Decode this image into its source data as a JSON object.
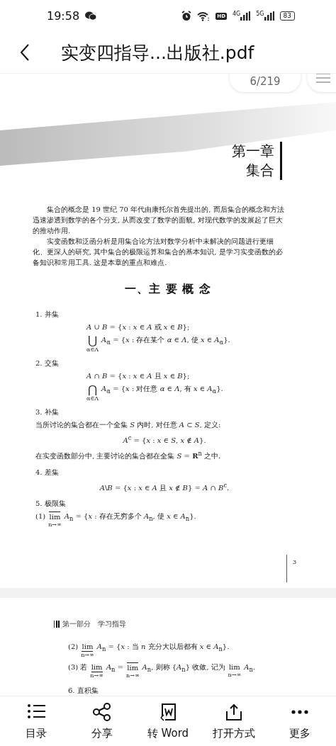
{
  "status_bar": {
    "time": "19:58",
    "hd": "HD",
    "networks": [
      "4G",
      "5G"
    ],
    "battery": "83"
  },
  "header": {
    "title": "实变四指导...出版社.pdf"
  },
  "page_indicator": "6/219",
  "page1": {
    "chapter": {
      "number": "第一章",
      "title": "集合"
    },
    "paragraphs": [
      "集合的概念是 19 世纪 70 年代由康托尔首先提出的, 而后集合的概念和方法迅速渗透到数学的各个分支, 从而改变了数学的面貌, 对现代数学的发展起了巨大的推动作用.",
      "实变函数和泛函分析是用集合论方法对数学分析中未解决的问题进行更细化、更深人的研究, 其中集合的极限运算和集合的基本知识, 是学习实变函数的必备知识和常用工具. 这是本章的重点和难点."
    ],
    "section_heading": "一、主 要 概 念",
    "lines": [
      {
        "kind": "heading",
        "parts": [
          {
            "text": "1. 并集"
          }
        ]
      },
      {
        "kind": "formula",
        "parts": [
          {
            "text": "*A* ∪ *B* = {*x* : *x* ∈ *A* 或 *x* ∈ *B*};"
          }
        ]
      },
      {
        "kind": "formula",
        "parts": [
          {
            "op": "⋃",
            "overline": false,
            "underline": false,
            "under": "α∈Λ"
          },
          {
            "text": "*A*$_{α}$ = {*x* : 存在某个 *α* ∈ *Λ*, 使 *x* ∈ *A*$_{α}$}."
          }
        ]
      },
      {
        "kind": "heading",
        "parts": [
          {
            "text": "2. 交集"
          }
        ]
      },
      {
        "kind": "formula",
        "parts": [
          {
            "text": "*A* ∩ *B* = {*x* : *x* ∈ *A* 且 *x* ∈ *B*};"
          }
        ]
      },
      {
        "kind": "formula",
        "parts": [
          {
            "op": "⋂",
            "overline": false,
            "underline": false,
            "under": "α∈Λ"
          },
          {
            "text": "*A*$_{α}$ = {*x* : 对任意 *α* ∈ *Λ*, 有 *x* ∈ *A*$_{α}$}."
          }
        ]
      },
      {
        "kind": "heading",
        "parts": [
          {
            "text": "3. 补集"
          }
        ]
      },
      {
        "kind": "text",
        "parts": [
          {
            "text": "当所讨论的集合都在一个全集 *S* 内时, 对任意 *A* ⊂ *S*, 定义:"
          }
        ]
      },
      {
        "kind": "center",
        "parts": [
          {
            "text": "*A*$^{c}$ = {*x* : *x* ∈ *S*, *x* ∉ *A*}."
          }
        ]
      },
      {
        "kind": "text",
        "parts": [
          {
            "text": "在实变函数部分中, 主要讨论的集合都在全集 *S* = **R**$^{n}$ 之中."
          }
        ]
      },
      {
        "kind": "heading",
        "parts": [
          {
            "text": "4. 差集"
          }
        ]
      },
      {
        "kind": "center",
        "parts": [
          {
            "text": "*A*\\*B* = {*x* : *x* ∈ *A* 且 *x* ∉ *B*} = *A* ∩ *B*$^{c}$."
          }
        ]
      },
      {
        "kind": "heading",
        "parts": [
          {
            "text": "5. 极限集"
          }
        ]
      },
      {
        "kind": "text",
        "parts": [
          {
            "text": "(1)"
          },
          {
            "op": "lim",
            "overline": true,
            "underline": false,
            "under": "n→∞"
          },
          {
            "text": "*A*$_{n}$ = {*x* : 存在无穷多个 *A*$_{n}$, 使 *x* ∈ *A*$_{n}$}."
          }
        ]
      }
    ],
    "page_number": "3"
  },
  "page2": {
    "running_header": "第一部分　学习指导",
    "lines": [
      {
        "kind": "text",
        "parts": [
          {
            "text": "(2)"
          },
          {
            "op": "lim",
            "overline": false,
            "underline": true,
            "under": "n→∞"
          },
          {
            "text": "*A*$_{n}$ = {*x* : 当 *n* 充分大以后都有 *x* ∈ *A*$_{n}$}."
          }
        ]
      },
      {
        "kind": "text",
        "parts": [
          {
            "text": "(3) 若"
          },
          {
            "op": "lim",
            "overline": false,
            "underline": true,
            "under": "n→∞"
          },
          {
            "text": "*A*$_{n}$ ="
          },
          {
            "op": "lim",
            "overline": true,
            "underline": false,
            "under": "n→∞"
          },
          {
            "text": "*A*$_{n}$, 则称 {*A*$_{n}$} 收敛, 记为"
          },
          {
            "op": "lim",
            "overline": false,
            "underline": false,
            "under": "n→∞"
          },
          {
            "text": "*A*$_{n}$."
          }
        ]
      },
      {
        "kind": "heading",
        "parts": [
          {
            "text": "6. 直积集"
          }
        ]
      }
    ]
  },
  "toolbar": [
    {
      "label": "目录"
    },
    {
      "label": "分享"
    },
    {
      "label": "转 Word"
    },
    {
      "label": "打开方式"
    },
    {
      "label": "更多"
    }
  ]
}
